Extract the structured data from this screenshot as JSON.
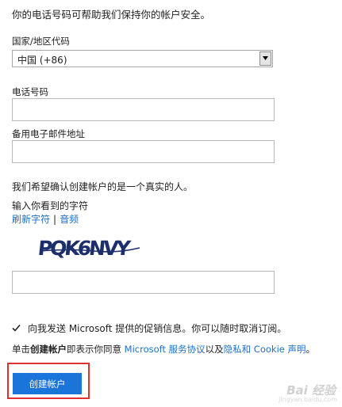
{
  "intro": "你的电话号码可帮助我们保持你的帐户安全。",
  "country": {
    "label": "国家/地区代码",
    "selected": "中国 (+86)"
  },
  "phone": {
    "label": "电话号码",
    "value": ""
  },
  "backup_email": {
    "label": "备用电子邮件地址",
    "value": ""
  },
  "human_check": {
    "heading": "我们希望确认创建帐户的是一个真实的人。",
    "prompt": "输入你看到的字符",
    "refresh_link": "刷新字符",
    "separator": "|",
    "audio_link": "音频",
    "captcha_text": "PQK6NVY",
    "input_value": ""
  },
  "promo": {
    "checked": true,
    "text": "向我发送 Microsoft 提供的促销信息。你可以随时取消订阅。"
  },
  "terms": {
    "prefix": "单击",
    "bold": "创建帐户",
    "middle": "即表示你同意 ",
    "link1": "Microsoft 服务协议",
    "conj": "以及",
    "link2": "隐私和 Cookie 声明",
    "suffix": "。"
  },
  "create_button": "创建帐户",
  "watermark": {
    "main": "Bai 经验",
    "sub": "jingyan.baidu.com"
  },
  "colors": {
    "link": "#1f6fc5",
    "button": "#1b74d9",
    "highlight_border": "#e03030"
  }
}
